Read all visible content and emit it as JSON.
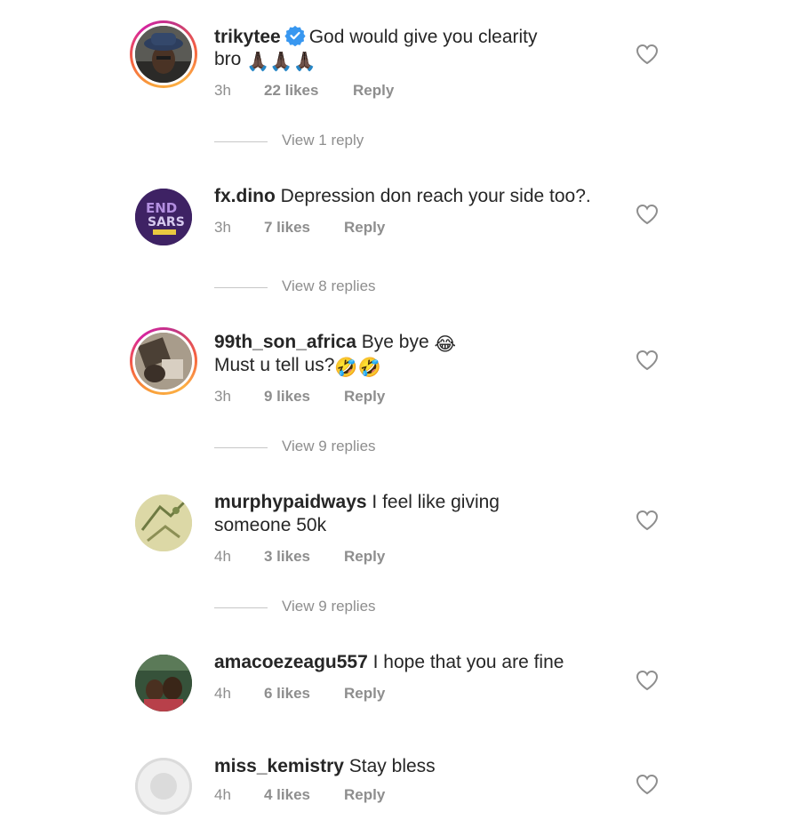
{
  "comments": [
    {
      "username": "trikytee",
      "verified": true,
      "text_line1": "God would give you clearity",
      "text_line2": "bro",
      "emoji_line2": "🙏🏿🙏🏿🙏🏿",
      "time": "3h",
      "likes": "22 likes",
      "reply": "Reply",
      "view_replies": "View 1 reply",
      "has_story_ring": true,
      "avatar_icon": "profile-photo-hat"
    },
    {
      "username": "fx.dino",
      "verified": false,
      "text_line1": "Depression don reach your side too?.",
      "time": "3h",
      "likes": "7 likes",
      "reply": "Reply",
      "view_replies": "View 8 replies",
      "has_story_ring": false,
      "avatar_icon": "endsars-logo"
    },
    {
      "username": "99th_son_africa",
      "verified": false,
      "text_line1": "Bye bye",
      "emoji_line1": "😂",
      "text_line2": "Must u tell us?",
      "emoji_line2": "🤣🤣",
      "time": "3h",
      "likes": "9 likes",
      "reply": "Reply",
      "view_replies": "View 9 replies",
      "has_story_ring": true,
      "avatar_icon": "profile-photo"
    },
    {
      "username": "murphypaidways",
      "verified": false,
      "text_line1": "I feel like giving",
      "text_line2": "someone 50k",
      "time": "4h",
      "likes": "3 likes",
      "reply": "Reply",
      "view_replies": "View 9 replies",
      "has_story_ring": false,
      "avatar_icon": "profile-photo"
    },
    {
      "username": "amacoezeagu557",
      "verified": false,
      "text_line1": "I hope that you are fine",
      "time": "4h",
      "likes": "6 likes",
      "reply": "Reply",
      "has_story_ring": false,
      "avatar_icon": "profile-photo"
    },
    {
      "username": "miss_kemistry",
      "verified": false,
      "text_line1": "Stay bless",
      "time": "4h",
      "likes": "4 likes",
      "reply": "Reply",
      "has_story_ring": false,
      "avatar_icon": "default-avatar"
    }
  ],
  "colors": {
    "text": "#262626",
    "muted": "#8e8e8e",
    "verified": "#3897f0",
    "divider": "#c7c7c7"
  }
}
